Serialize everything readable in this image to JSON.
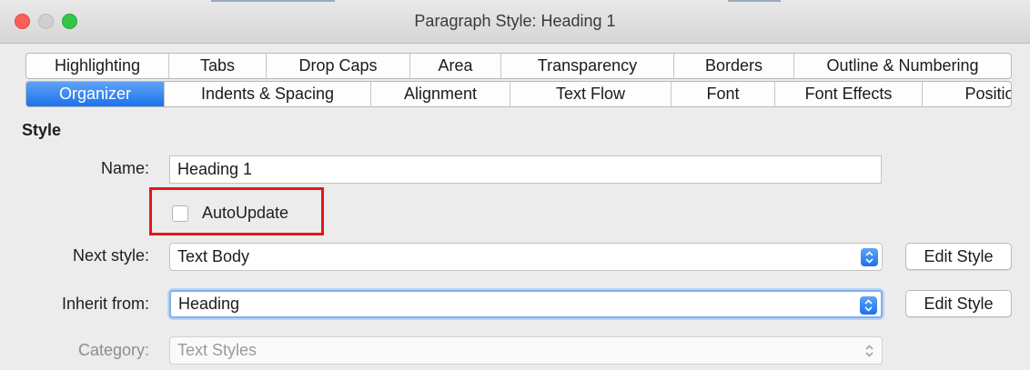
{
  "window": {
    "title": "Paragraph Style: Heading 1"
  },
  "tabs": {
    "row1": [
      "Highlighting",
      "Tabs",
      "Drop Caps",
      "Area",
      "Transparency",
      "Borders",
      "Outline & Numbering"
    ],
    "row2": [
      "Organizer",
      "Indents & Spacing",
      "Alignment",
      "Text Flow",
      "Font",
      "Font Effects",
      "Position"
    ],
    "active": "Organizer"
  },
  "style_section": {
    "heading": "Style",
    "name_label": "Name:",
    "name_value": "Heading 1",
    "autoupdate_label": "AutoUpdate",
    "autoupdate_checked": false,
    "next_style_label": "Next style:",
    "next_style_value": "Text Body",
    "inherit_from_label": "Inherit from:",
    "inherit_from_value": "Heading",
    "category_label": "Category:",
    "category_value": "Text Styles",
    "edit_style_label": "Edit Style"
  },
  "colors": {
    "accent": "#1c72ec",
    "highlight_border": "#e4161b"
  }
}
